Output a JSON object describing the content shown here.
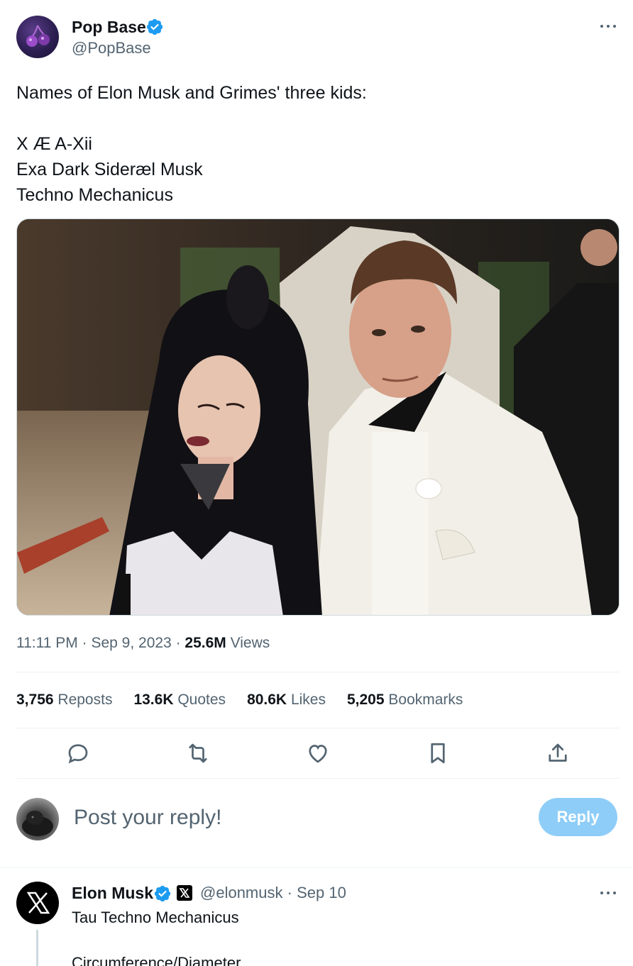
{
  "tweet": {
    "author_name": "Pop Base",
    "author_handle": "@PopBase",
    "text": "Names of Elon Musk and Grimes' three kids:\n\nX Æ A-Xii\nExa Dark Sideræl Musk\nTechno Mechanicus",
    "time": "11:11 PM",
    "date": "Sep 9, 2023",
    "views_count": "25.6M",
    "views_label": "Views",
    "separator": "·"
  },
  "stats": {
    "reposts_count": "3,756",
    "reposts_label": "Reposts",
    "quotes_count": "13.6K",
    "quotes_label": "Quotes",
    "likes_count": "80.6K",
    "likes_label": "Likes",
    "bookmarks_count": "5,205",
    "bookmarks_label": "Bookmarks"
  },
  "icons": {
    "reply": "reply-icon",
    "repost": "repost-icon",
    "like": "heart-icon",
    "bookmark": "bookmark-icon",
    "share": "share-icon",
    "verified": "verified-badge-icon",
    "more": "more-dots-icon"
  },
  "composer": {
    "placeholder": "Post your reply!",
    "button_label": "Reply"
  },
  "reply": {
    "author_name": "Elon Musk",
    "author_handle": "@elonmusk",
    "date": "Sep 10",
    "text": "Tau Techno Mechanicus\n\nCircumference/Diameter"
  },
  "colors": {
    "verified_blue": "#1d9bf0",
    "secondary_text": "#536471",
    "reply_button": "#8ecdf8"
  }
}
